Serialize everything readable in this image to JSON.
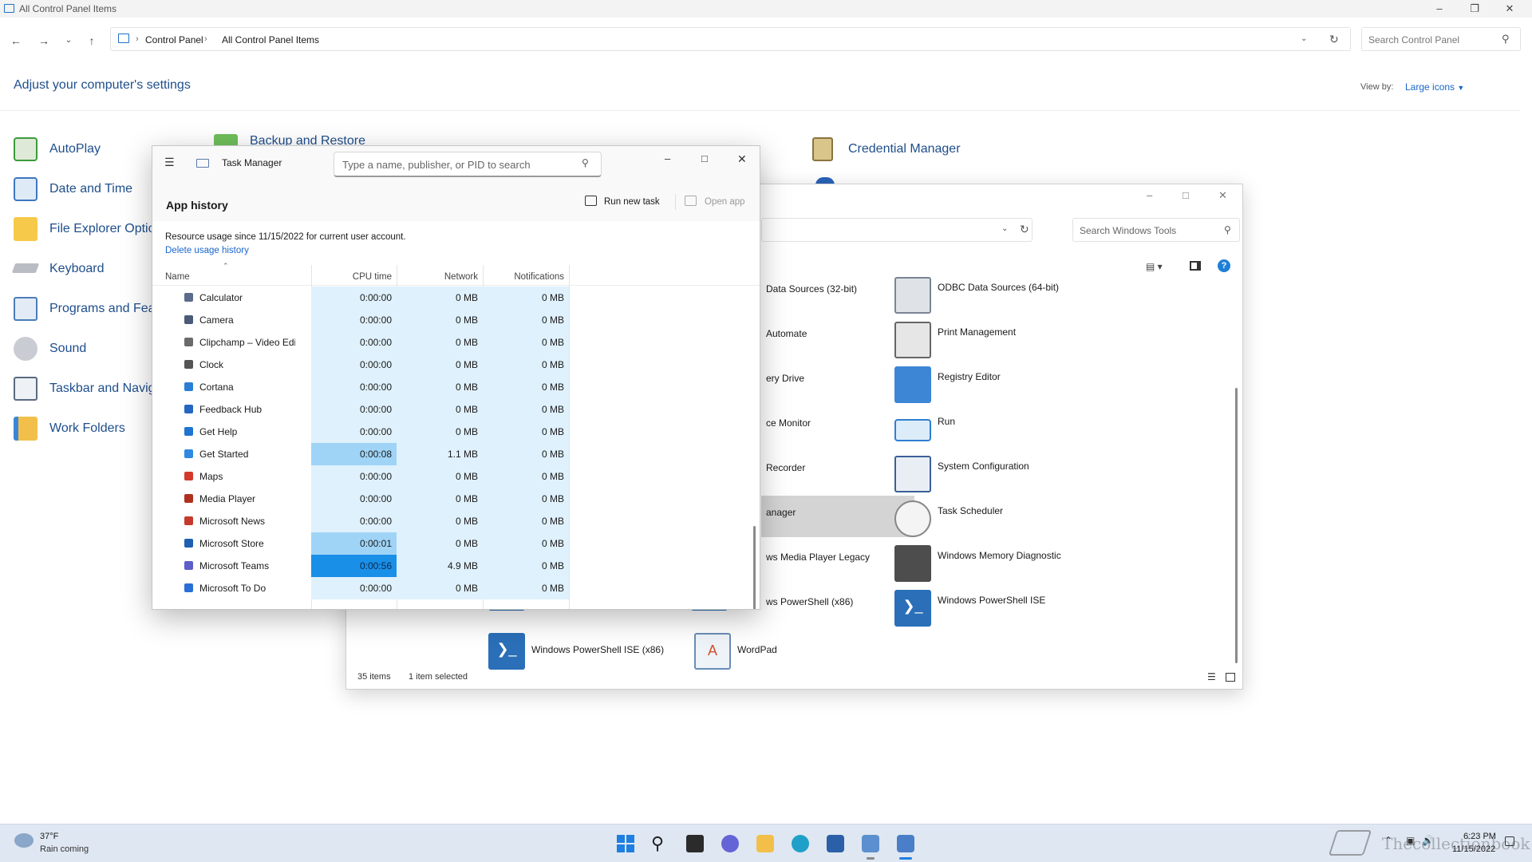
{
  "control_panel": {
    "window_title": "All Control Panel Items",
    "breadcrumb": [
      "Control Panel",
      "All Control Panel Items"
    ],
    "search_placeholder": "Search Control Panel",
    "heading": "Adjust your computer's settings",
    "view_by_label": "View by:",
    "view_by_value": "Large icons",
    "items_col1": [
      "AutoPlay",
      "Date and Time",
      "File Explorer Optio",
      "Keyboard",
      "Programs and Feat",
      "Sound",
      "Taskbar and Navig",
      "Work Folders"
    ],
    "items_top": [
      "Backup and Restore",
      "Credential Manager"
    ]
  },
  "windows_tools": {
    "search_placeholder": "Search Windows Tools",
    "col_left_items": [
      "Data Sources (32-bit)",
      "Automate",
      "ery Drive",
      "ce Monitor",
      "Recorder",
      "anager",
      "ws Media Player Legacy",
      "ws PowerShell (x86)"
    ],
    "col_right_items": [
      "ODBC Data Sources (64-bit)",
      "Print Management",
      "Registry Editor",
      "Run",
      "System Configuration",
      "Task Scheduler",
      "Windows Memory Diagnostic",
      "Windows PowerShell ISE"
    ],
    "bottom_items": [
      "Windows PowerShell ISE (x86)",
      "WordPad"
    ],
    "status_count": "35 items",
    "status_selected": "1 item selected"
  },
  "task_manager": {
    "title": "Task Manager",
    "search_placeholder": "Type a name, publisher, or PID to search",
    "page_title": "App history",
    "run_new_task": "Run new task",
    "open_app": "Open app",
    "resource_text": "Resource usage since 11/15/2022 for current user account.",
    "delete_history": "Delete usage history",
    "columns": {
      "name": "Name",
      "cpu": "CPU time",
      "network": "Network",
      "notifications": "Notifications"
    },
    "rows": [
      {
        "name": "Calculator",
        "cpu": "0:00:00",
        "network": "0 MB",
        "notifications": "0 MB",
        "cpu_level": 0,
        "icon_color": "#5b6b8c"
      },
      {
        "name": "Camera",
        "cpu": "0:00:00",
        "network": "0 MB",
        "notifications": "0 MB",
        "cpu_level": 0,
        "icon_color": "#4a5a78"
      },
      {
        "name": "Clipchamp – Video Edit...",
        "cpu": "0:00:00",
        "network": "0 MB",
        "notifications": "0 MB",
        "cpu_level": 0,
        "icon_color": "#6a6a6a"
      },
      {
        "name": "Clock",
        "cpu": "0:00:00",
        "network": "0 MB",
        "notifications": "0 MB",
        "cpu_level": 0,
        "icon_color": "#555555"
      },
      {
        "name": "Cortana",
        "cpu": "0:00:00",
        "network": "0 MB",
        "notifications": "0 MB",
        "cpu_level": 0,
        "icon_color": "#2a7fd4"
      },
      {
        "name": "Feedback Hub",
        "cpu": "0:00:00",
        "network": "0 MB",
        "notifications": "0 MB",
        "cpu_level": 0,
        "icon_color": "#2566c2"
      },
      {
        "name": "Get Help",
        "cpu": "0:00:00",
        "network": "0 MB",
        "notifications": "0 MB",
        "cpu_level": 0,
        "icon_color": "#1f74d0"
      },
      {
        "name": "Get Started",
        "cpu": "0:00:08",
        "network": "1.1 MB",
        "notifications": "0 MB",
        "cpu_level": 1,
        "icon_color": "#2d8ae0"
      },
      {
        "name": "Maps",
        "cpu": "0:00:00",
        "network": "0 MB",
        "notifications": "0 MB",
        "cpu_level": 0,
        "icon_color": "#d43a2a"
      },
      {
        "name": "Media Player",
        "cpu": "0:00:00",
        "network": "0 MB",
        "notifications": "0 MB",
        "cpu_level": 0,
        "icon_color": "#b03020"
      },
      {
        "name": "Microsoft News",
        "cpu": "0:00:00",
        "network": "0 MB",
        "notifications": "0 MB",
        "cpu_level": 0,
        "icon_color": "#c53a2d"
      },
      {
        "name": "Microsoft Store",
        "cpu": "0:00:01",
        "network": "0 MB",
        "notifications": "0 MB",
        "cpu_level": 1,
        "icon_color": "#1f5fb0"
      },
      {
        "name": "Microsoft Teams",
        "cpu": "0:00:56",
        "network": "4.9 MB",
        "notifications": "0 MB",
        "cpu_level": 2,
        "icon_color": "#5b5fc7"
      },
      {
        "name": "Microsoft To Do",
        "cpu": "0:00:00",
        "network": "0 MB",
        "notifications": "0 MB",
        "cpu_level": 0,
        "icon_color": "#2a6fd6"
      }
    ]
  },
  "taskbar": {
    "weather_temp": "37°F",
    "weather_desc": "Rain coming",
    "time": "6:23 PM",
    "date": "11/15/2022",
    "watermark": "Thecollectionbook"
  },
  "colors": {
    "link_blue": "#1e4e8c",
    "heatmap_low": "#dff1fd",
    "heatmap_mid": "#9fd4f7",
    "heatmap_high": "#1a8fe8"
  }
}
